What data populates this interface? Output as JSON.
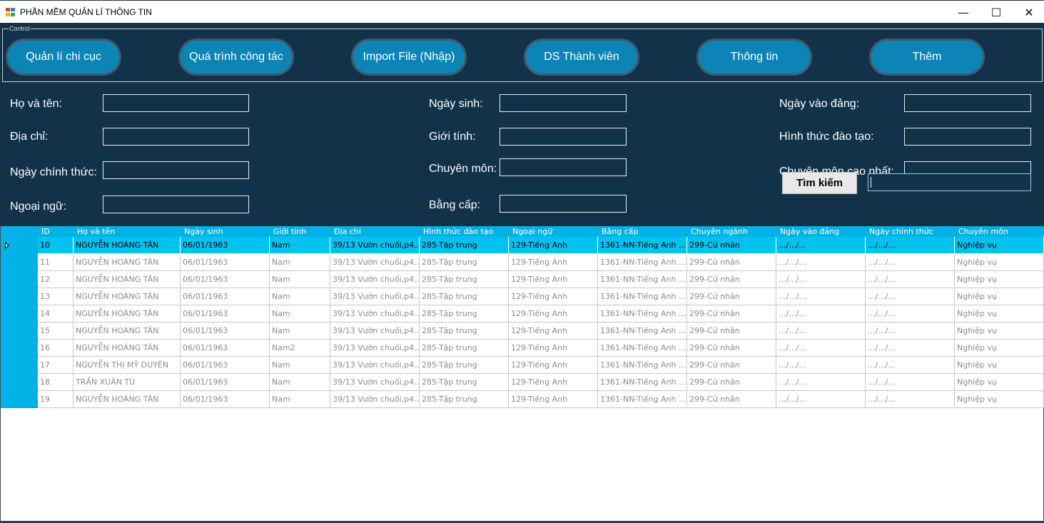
{
  "window": {
    "title": "PHẦN MỀM QUẢN LÍ THÔNG TIN",
    "icon": "app-window-icon",
    "minimize_glyph": "—",
    "maximize_glyph": "☐",
    "close_glyph": "✕"
  },
  "control_group": {
    "label": "Control",
    "buttons": [
      {
        "label": "Quản lí chi cục"
      },
      {
        "label": "Quá trình công tác"
      },
      {
        "label": "Import File (Nhập)"
      },
      {
        "label": "DS Thành viên"
      },
      {
        "label": "Thông tin"
      },
      {
        "label": "Thêm"
      }
    ]
  },
  "form": {
    "ho_va_ten": "Họ và tên:",
    "dia_chi": "Địa chỉ:",
    "ngay_chinh_thuc": "Ngày chính thức:",
    "ngoai_ngu": "Ngoại ngữ:",
    "ngay_sinh": "Ngày sinh:",
    "gioi_tinh": "Giới tính:",
    "chuyen_mon": "Chuyên môn:",
    "bang_cap": "Bằng cấp:",
    "ngay_vao_dang": "Ngày vào đảng:",
    "hinh_thuc_dao_tao": "Hình thức đào tạo:",
    "chuyen_mon_cao_nhat": "Chuyên môn cao nhất:",
    "search_button": "Tìm kiếm"
  },
  "colors": {
    "panel_bg": "#12324a",
    "accent": "#0c84b6",
    "grid_header": "#02b1e6",
    "selected_row": "#00c2ef"
  },
  "table": {
    "columns": [
      "ID",
      "Họ và tên",
      "Ngày sinh",
      "Giới tính",
      "Địa chỉ",
      "Hình thức đào tạo",
      "Ngoại ngữ",
      "Bằng cấp",
      "Chuyên ngành",
      "Ngày vào đảng",
      "Ngày chính thức",
      "Chuyên môn"
    ],
    "rows": [
      [
        "10",
        "NGUYỄN HOÀNG TÂN",
        "06/01/1963",
        "Nam",
        "39/13 Vườn chuối,p4...",
        "285-Tập trung",
        "129-Tiếng Anh",
        "1361-NN-Tiếng Anh ...",
        "299-Cử nhân",
        ".../.../...",
        ".../.../...",
        "Nghiệp vụ"
      ],
      [
        "11",
        "NGUYỄN HOÀNG TÂN",
        "06/01/1963",
        "Nam",
        "39/13 Vườn chuối,p4...",
        "285-Tập trung",
        "129-Tiếng Anh",
        "1361-NN-Tiếng Anh ...",
        "299-Cử nhân",
        ".../.../...",
        ".../.../...",
        "Nghiệp vụ"
      ],
      [
        "12",
        "NGUYỄN HOÀNG TÂN",
        "06/01/1963",
        "Nam",
        "39/13 Vườn chuối,p4...",
        "285-Tập trung",
        "129-Tiếng Anh",
        "1361-NN-Tiếng Anh ...",
        "299-Cử nhân",
        ".../.../...",
        ".../.../...",
        "Nghiệp vụ"
      ],
      [
        "13",
        "NGUYỄN HOÀNG TÂN",
        "06/01/1963",
        "Nam",
        "39/13 Vườn chuối,p4...",
        "285-Tập trung",
        "129-Tiếng Anh",
        "1361-NN-Tiếng Anh ...",
        "299-Cử nhân",
        ".../.../...",
        ".../.../...",
        "Nghiệp vụ"
      ],
      [
        "14",
        "NGUYỄN HOÀNG TÂN",
        "06/01/1963",
        "Nam",
        "39/13 Vườn chuối,p4...",
        "285-Tập trung",
        "129-Tiếng Anh",
        "1361-NN-Tiếng Anh ...",
        "299-Cử nhân",
        ".../.../...",
        ".../.../...",
        "Nghiệp vụ"
      ],
      [
        "15",
        "NGUYỄN HOÀNG TÂN",
        "06/01/1963",
        "Nam",
        "39/13 Vườn chuối,p4...",
        "285-Tập trung",
        "129-Tiếng Anh",
        "1361-NN-Tiếng Anh ...",
        "299-Cử nhân",
        ".../.../...",
        ".../.../...",
        "Nghiệp vụ"
      ],
      [
        "16",
        "NGUYỄN HOÀNG TÂN",
        "06/01/1963",
        "Nam2",
        "39/13 Vườn chuối,p4...",
        "285-Tập trung",
        "129-Tiếng Anh",
        "1361-NN-Tiếng Anh ...",
        "299-Cử nhân",
        ".../.../...",
        ".../.../...",
        "Nghiệp vụ"
      ],
      [
        "17",
        "NGUYỄN THỊ MỸ DUYÊN",
        "06/01/1963",
        "Nam",
        "39/13 Vườn chuối,p4...",
        "285-Tập trung",
        "129-Tiếng Anh",
        "1361-NN-Tiếng Anh ...",
        "299-Cử nhân",
        ".../.../...",
        ".../.../...",
        "Nghiệp vụ"
      ],
      [
        "18",
        "TRẦN XUÂN TÚ",
        "06/01/1963",
        "Nam",
        "39/13 Vườn chuối,p4...",
        "285-Tập trung",
        "129-Tiếng Anh",
        "1361-NN-Tiếng Anh ...",
        "299-Cử nhân",
        ".../.../...",
        ".../.../...",
        "Nghiệp vụ"
      ],
      [
        "19",
        "NGUYỄN HOÀNG TÂN",
        "06/01/1963",
        "Nam",
        "39/13 Vườn chuối,p4...",
        "285-Tập trung",
        "129-Tiếng Anh",
        "1361-NN-Tiếng Anh ...",
        "299-Cử nhân",
        ".../.../...",
        ".../.../...",
        "Nghiệp vụ"
      ]
    ]
  }
}
